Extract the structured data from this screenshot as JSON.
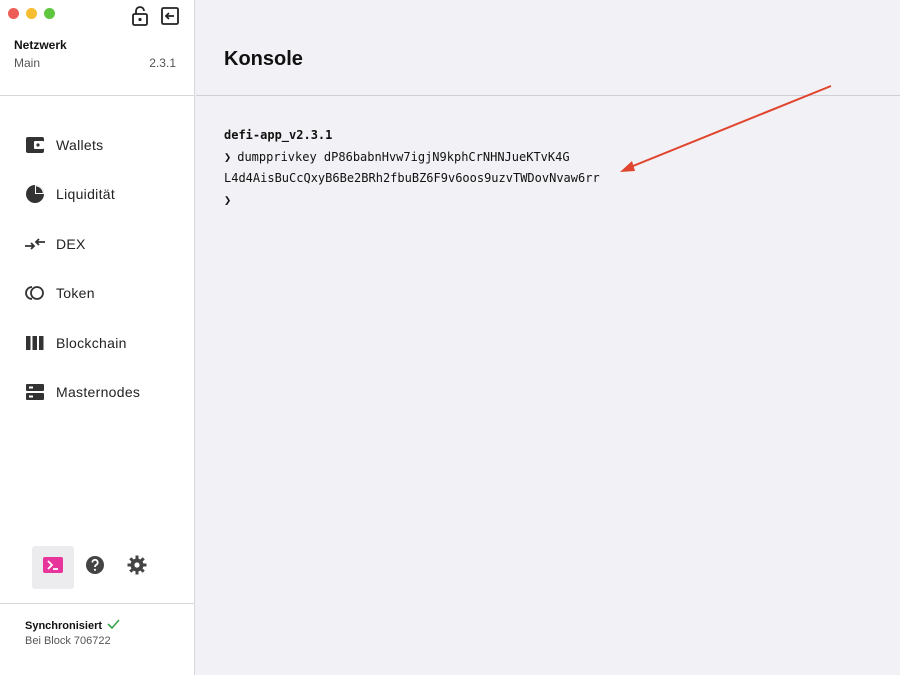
{
  "network": {
    "label": "Netzwerk",
    "name": "Main",
    "version": "2.3.1"
  },
  "top_icons": [
    "lock-open-icon",
    "exit-icon"
  ],
  "nav": [
    {
      "label": "Wallets",
      "icon": "wallet-icon"
    },
    {
      "label": "Liquidität",
      "icon": "pie-chart-icon"
    },
    {
      "label": "DEX",
      "icon": "swap-icon"
    },
    {
      "label": "Token",
      "icon": "token-icon"
    },
    {
      "label": "Blockchain",
      "icon": "blocks-icon"
    },
    {
      "label": "Masternodes",
      "icon": "server-icon"
    }
  ],
  "tools": [
    "console-icon",
    "help-icon",
    "settings-icon"
  ],
  "sync": {
    "title": "Synchronisiert",
    "block": "Bei Block 706722"
  },
  "page": {
    "title": "Konsole"
  },
  "console": {
    "header": "defi-app_v2.3.1",
    "prompt_symbol": "❯",
    "command": "dumpprivkey dP86babnHvw7igjN9kphCrNHNJueKTvK4G",
    "output": "L4d4AisBuCcQxyB6Be2BRh2fbuBZ6F9v6oos9uzvTWDovNvaw6rr"
  },
  "colors": {
    "accent": "#e8359c",
    "annotation_arrow": "#e0452f",
    "sync_check": "#3aa34a"
  }
}
